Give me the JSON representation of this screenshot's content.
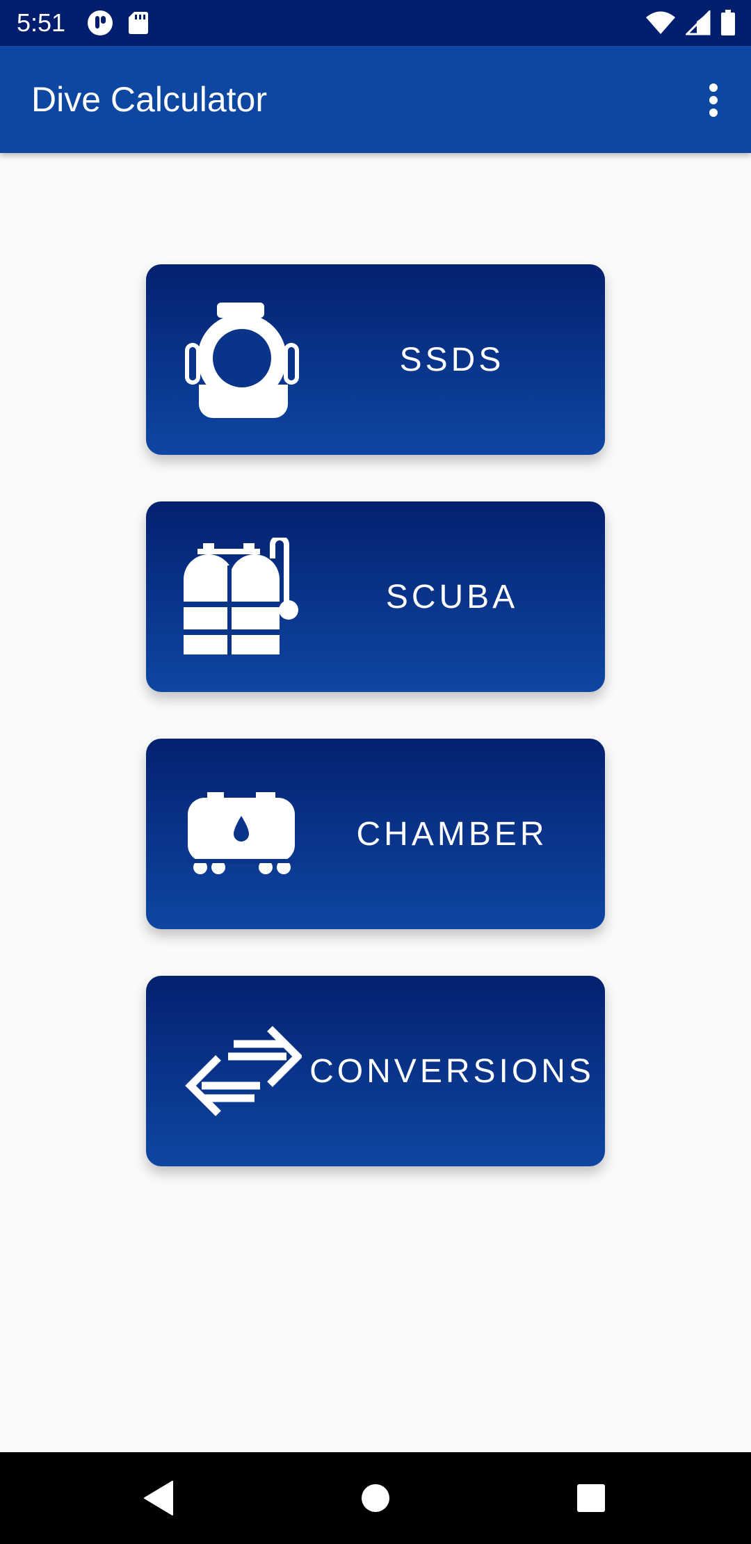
{
  "status_bar": {
    "time": "5:51",
    "left_icons": [
      "app-notification-icon",
      "sd-card-icon"
    ],
    "right_icons": [
      "wifi-icon",
      "cell-signal-icon",
      "battery-icon"
    ]
  },
  "app_bar": {
    "title": "Dive Calculator",
    "menu_icon": "more-vert-icon"
  },
  "cards": [
    {
      "label": "SSDS",
      "icon": "diving-helmet-icon"
    },
    {
      "label": "SCUBA",
      "icon": "scuba-tanks-icon"
    },
    {
      "label": "CHAMBER",
      "icon": "chamber-icon"
    },
    {
      "label": "CONVERSIONS",
      "icon": "swap-arrows-icon"
    }
  ],
  "nav_bar": {
    "back": "back-triangle-icon",
    "home": "home-circle-icon",
    "recents": "recents-square-icon"
  },
  "colors": {
    "status_bar": "#001d6e",
    "app_bar": "#0d47a1",
    "card_top": "#03216f",
    "card_bottom": "#0f46a3",
    "background": "#fafafa"
  }
}
